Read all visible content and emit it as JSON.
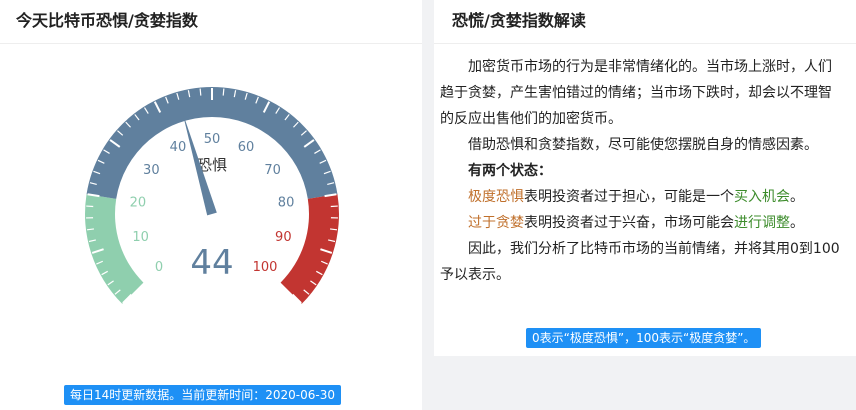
{
  "left": {
    "title": "今天比特币恐惧/贪婪指数",
    "update_note": "每日14时更新数据。当前更新时间：2020-06-30"
  },
  "gauge": {
    "value": 44,
    "value_text": "44",
    "status_label": "恐惧",
    "min": 0,
    "max": 100,
    "tick_labels": [
      "0",
      "10",
      "20",
      "30",
      "40",
      "50",
      "60",
      "70",
      "80",
      "90",
      "100"
    ],
    "colors": {
      "green": "#8fcfae",
      "blue": "#60809e",
      "red": "#c23531",
      "pointer": "#60809e"
    }
  },
  "right": {
    "title": "恐慌/贪婪指数解读",
    "para1": "加密货币市场的行为是非常情绪化的。当市场上涨时，人们趋于贪婪，产生害怕错过的情绪；当市场下跌时，却会以不理智的反应出售他们的加密货币。",
    "para2": "借助恐惧和贪婪指数，尽可能使您摆脱自身的情感因素。",
    "states_heading": "有两个状态：",
    "fear_term": "极度恐惧",
    "fear_text": "表明投资者过于担心，可能是一个",
    "fear_opportunity": "买入机会",
    "fear_end": "。",
    "greed_term": "过于贪婪",
    "greed_text": "表明投资者过于兴奋，市场可能会",
    "greed_opportunity": "进行调整",
    "greed_end": "。",
    "para3": "因此，我们分析了比特币市场的当前情绪，并将其用0到100予以表示。",
    "note": "0表示“极度恐惧”，100表示“极度贪婪”。"
  }
}
